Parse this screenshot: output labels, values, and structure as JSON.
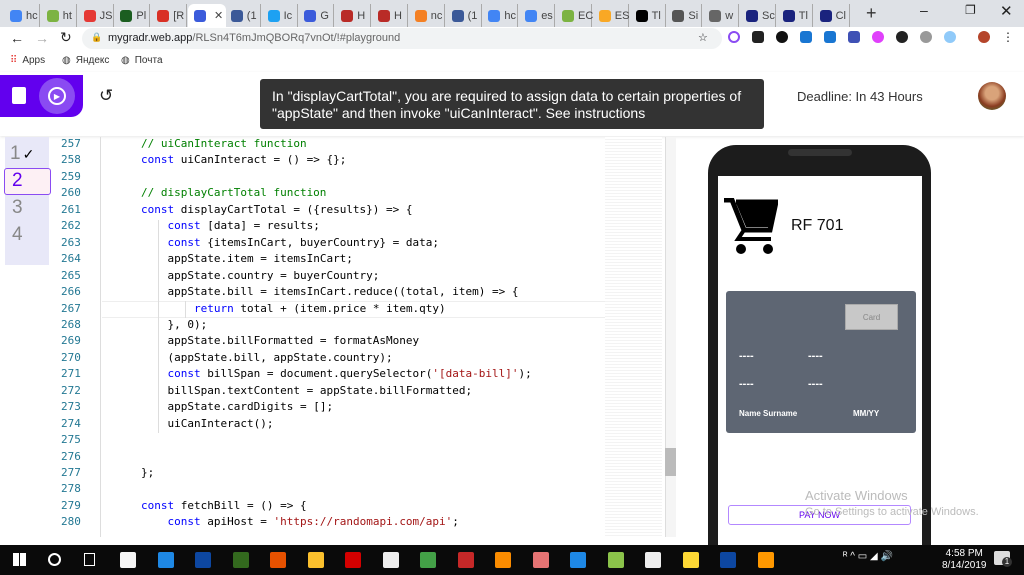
{
  "browser": {
    "tabs": [
      {
        "label": "hc",
        "color": "#4285f4"
      },
      {
        "label": "ht",
        "color": "#7cb342"
      },
      {
        "label": "JS",
        "color": "#e53935"
      },
      {
        "label": "Pl",
        "color": "#1b5e20"
      },
      {
        "label": "[R",
        "color": "#d93025"
      },
      {
        "label": "",
        "color": "#3b5bdb",
        "active": true
      },
      {
        "label": "(1",
        "color": "#3b5998"
      },
      {
        "label": "Ic",
        "color": "#1da1f2"
      },
      {
        "label": "G",
        "color": "#3b5bdb"
      },
      {
        "label": "H",
        "color": "#b92b27"
      },
      {
        "label": "H",
        "color": "#b92b27"
      },
      {
        "label": "nc",
        "color": "#f48024"
      },
      {
        "label": "(1",
        "color": "#3b5998"
      },
      {
        "label": "hc",
        "color": "#4285f4"
      },
      {
        "label": "es",
        "color": "#4285f4"
      },
      {
        "label": "EC",
        "color": "#7cb342"
      },
      {
        "label": "ES",
        "color": "#f9a825"
      },
      {
        "label": "Tl",
        "color": "#000000"
      },
      {
        "label": "Si",
        "color": "#555555"
      },
      {
        "label": "w",
        "color": "#666666"
      },
      {
        "label": "Sc",
        "color": "#1a237e"
      },
      {
        "label": "Tl",
        "color": "#1a237e"
      },
      {
        "label": "Cl",
        "color": "#1a237e"
      }
    ],
    "url_host": "mygradr.web.app",
    "url_path": "/RLSn4T6mJmQBORq7vnOt/!#playground",
    "bookmarks": [
      "Apps",
      "Яндекс",
      "Почта"
    ]
  },
  "app": {
    "tooltip": "In \"displayCartTotal\", you are required to assign data to certain properties of \"appState\" and then invoke \"uiCanInteract\". See instructions",
    "deadline": "Deadline: In 43 Hours",
    "steps": [
      "1",
      "2",
      "3",
      "4"
    ],
    "step_done_mark": "✓",
    "accent": "#6200ee"
  },
  "editor": {
    "lines": [
      {
        "n": "257",
        "i": 0,
        "t": [
          [
            "cm",
            "// uiCanInteract function"
          ]
        ]
      },
      {
        "n": "258",
        "i": 0,
        "t": [
          [
            "kw",
            "const"
          ],
          [
            "",
            "uiCanInteract = () => {};"
          ]
        ]
      },
      {
        "n": "259",
        "i": 0,
        "t": []
      },
      {
        "n": "260",
        "i": 0,
        "t": [
          [
            "cm",
            "// displayCartTotal function"
          ]
        ]
      },
      {
        "n": "261",
        "i": 0,
        "t": [
          [
            "kw",
            "const"
          ],
          [
            "",
            "displayCartTotal = ({results}) => {"
          ]
        ]
      },
      {
        "n": "262",
        "i": 1,
        "t": [
          [
            "kw",
            "const"
          ],
          [
            "",
            "[data] = results;"
          ]
        ]
      },
      {
        "n": "263",
        "i": 1,
        "t": [
          [
            "kw",
            "const"
          ],
          [
            "",
            "{itemsInCart, buyerCountry} = data;"
          ]
        ]
      },
      {
        "n": "264",
        "i": 1,
        "t": [
          [
            "",
            "appState.item = itemsInCart;"
          ]
        ]
      },
      {
        "n": "265",
        "i": 1,
        "t": [
          [
            "",
            "appState.country = buyerCountry;"
          ]
        ]
      },
      {
        "n": "266",
        "i": 1,
        "t": [
          [
            "",
            "appState.bill = itemsInCart.reduce((total, item) => {"
          ]
        ]
      },
      {
        "n": "267",
        "i": 2,
        "t": [
          [
            "kw",
            "return"
          ],
          [
            "",
            "total + (item.price * item.qty)"
          ]
        ]
      },
      {
        "n": "268",
        "i": 1,
        "t": [
          [
            "",
            "}, 0);"
          ]
        ]
      },
      {
        "n": "269",
        "i": 1,
        "t": [
          [
            "",
            "appState.billFormatted = formatAsMoney"
          ]
        ]
      },
      {
        "n": "270",
        "i": 1,
        "t": [
          [
            "",
            "(appState.bill, appState.country);"
          ]
        ]
      },
      {
        "n": "271",
        "i": 1,
        "t": [
          [
            "kw",
            "const"
          ],
          [
            "",
            "billSpan = document.querySelector("
          ],
          [
            "st",
            "'[data-bill]'"
          ],
          [
            "",
            ");"
          ]
        ]
      },
      {
        "n": "272",
        "i": 1,
        "t": [
          [
            "",
            "billSpan.textContent = appState.billFormatted;"
          ]
        ]
      },
      {
        "n": "273",
        "i": 1,
        "t": [
          [
            "",
            "appState.cardDigits = [];"
          ]
        ]
      },
      {
        "n": "274",
        "i": 1,
        "t": [
          [
            "",
            "uiCanInteract();"
          ]
        ]
      },
      {
        "n": "275",
        "i": 0,
        "t": []
      },
      {
        "n": "276",
        "i": 0,
        "t": []
      },
      {
        "n": "277",
        "i": 0,
        "t": [
          [
            "",
            "};"
          ]
        ]
      },
      {
        "n": "278",
        "i": 0,
        "t": []
      },
      {
        "n": "279",
        "i": 0,
        "t": [
          [
            "kw",
            "const"
          ],
          [
            "",
            "fetchBill = () => {"
          ]
        ]
      },
      {
        "n": "280",
        "i": 1,
        "t": [
          [
            "kw",
            "const"
          ],
          [
            "",
            "apiHost = "
          ],
          [
            "st",
            "'https://randomapi.com/api'"
          ],
          [
            "",
            ";"
          ]
        ]
      }
    ]
  },
  "preview": {
    "bill": "RF 701",
    "card_button": "Card",
    "digits": [
      "----",
      "----",
      "----",
      "----"
    ],
    "name": "Name Surname",
    "expiry": "MM/YY",
    "pay_button": "PAY NOW"
  },
  "watermark": {
    "title": "Activate Windows",
    "sub": "Go to Settings to activate Windows."
  },
  "taskbar": {
    "apps": [
      {
        "name": "store",
        "color": "#f5f5f5"
      },
      {
        "name": "edge",
        "color": "#1e88e5"
      },
      {
        "name": "photoshop",
        "color": "#0d47a1"
      },
      {
        "name": "dreamweaver",
        "color": "#33691e"
      },
      {
        "name": "illustrator",
        "color": "#e65100"
      },
      {
        "name": "file-explorer",
        "color": "#fbc02d"
      },
      {
        "name": "opera",
        "color": "#d50000"
      },
      {
        "name": "mail",
        "color": "#eeeeee"
      },
      {
        "name": "chrome",
        "color": "#43a047"
      },
      {
        "name": "app",
        "color": "#c62828"
      },
      {
        "name": "xampp",
        "color": "#fb8c00"
      },
      {
        "name": "paint",
        "color": "#e57373"
      },
      {
        "name": "vscode",
        "color": "#1e88e5"
      },
      {
        "name": "inkscape",
        "color": "#8bc34a"
      },
      {
        "name": "camera",
        "color": "#eeeeee"
      },
      {
        "name": "python",
        "color": "#fdd835"
      },
      {
        "name": "photoshop-2",
        "color": "#0d47a1"
      },
      {
        "name": "uc-browser",
        "color": "#ff9800"
      }
    ],
    "time": "4:58 PM",
    "date": "8/14/2019",
    "notifications": "1"
  }
}
